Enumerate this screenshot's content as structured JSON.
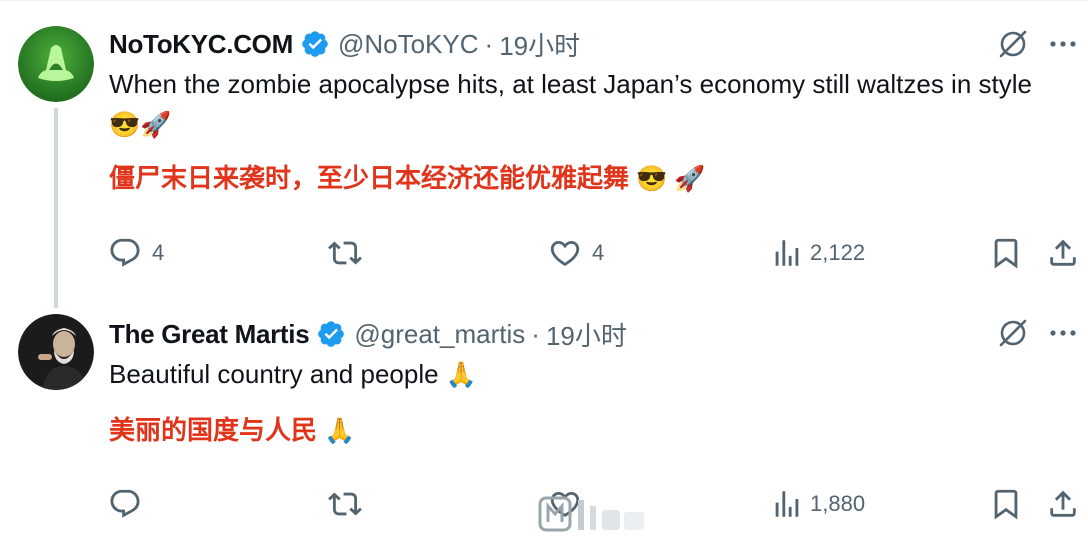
{
  "tweets": [
    {
      "display_name": "NoToKYC.COM",
      "handle": "@NoToKYC",
      "separator": "·",
      "time": "19小时",
      "text": "When the zombie apocalypse hits, at least Japan’s economy still waltzes in style",
      "text_emoji": "😎🚀",
      "translation": "僵尸末日来袭时，至少日本经济还能优雅起舞",
      "translation_emoji": "😎 🚀",
      "stats": {
        "replies": "4",
        "retweets": "",
        "likes": "4",
        "views": "2,122"
      },
      "avatar_icon": "green-hood-logo-icon"
    },
    {
      "display_name": "The Great Martis",
      "handle": "@great_martis",
      "separator": "·",
      "time": "19小时",
      "text": "Beautiful country and people",
      "text_emoji": "🙏",
      "translation": "美丽的国度与人民",
      "translation_emoji": "🙏",
      "stats": {
        "replies": "",
        "retweets": "",
        "likes": "",
        "views": "1,880"
      },
      "avatar_icon": "portrait-photo-icon"
    }
  ],
  "colors": {
    "verified": "#1d9bf0",
    "icon_gray": "#536471",
    "translation": "#e0341b",
    "thread_line": "#cfd9de"
  }
}
